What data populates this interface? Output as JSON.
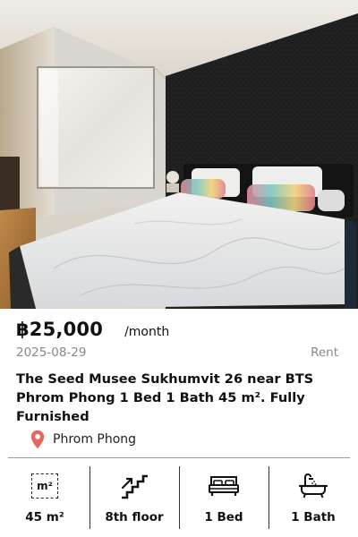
{
  "listing": {
    "photo_alt_icon": "bedroom-photo",
    "price": "฿25,000",
    "price_period": "/month",
    "date": "2025-08-29",
    "listing_type": "Rent",
    "title": "The Seed Musee Sukhumvit 26 near BTS Phrom Phong 1 Bed 1 Bath 45 m². Fully Furnished",
    "location": "Phrom Phong",
    "location_icon": "map-pin-icon",
    "location_icon_color": "#e5675f"
  },
  "features": [
    {
      "icon": "square-meter-icon",
      "icon_text": "m²",
      "label": "45 m²"
    },
    {
      "icon": "stairs-icon",
      "label": "8th floor"
    },
    {
      "icon": "bed-icon",
      "label": "1 Bed"
    },
    {
      "icon": "bathtub-icon",
      "label": "1 Bath"
    }
  ]
}
